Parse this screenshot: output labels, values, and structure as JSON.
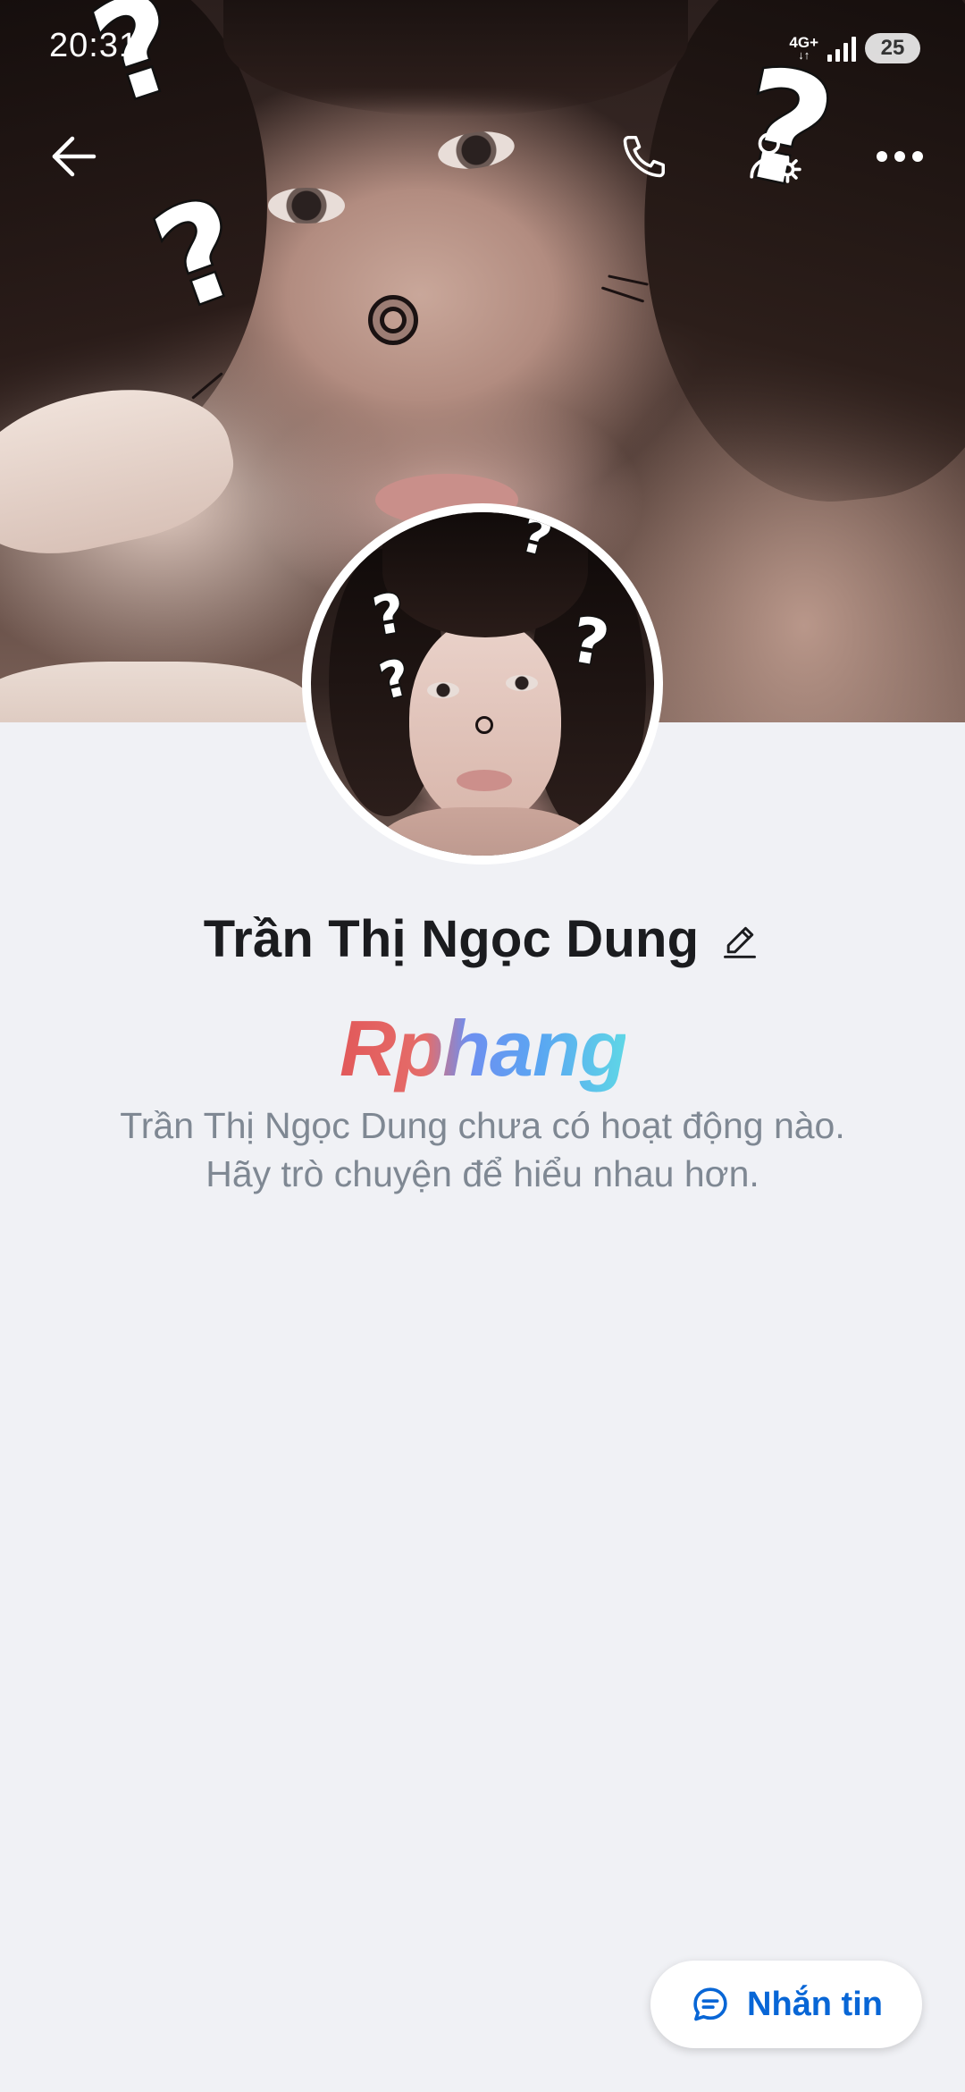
{
  "status_bar": {
    "time": "20:31",
    "network_type": "4G+",
    "battery_level": "25"
  },
  "toolbar": {
    "back_icon": "arrow-left-icon",
    "call_icon": "phone-icon",
    "settings_icon": "user-gear-icon",
    "more_icon": "ellipsis-icon"
  },
  "profile": {
    "name": "Trần Thị Ngọc Dung",
    "edit_icon": "pencil-icon",
    "watermark": "Rphang",
    "activity_message": "Trần Thị Ngọc Dung chưa có hoạt động nào. Hãy trò chuyện để hiểu nhau hơn."
  },
  "message_button": {
    "icon": "chat-bubble-icon",
    "label": "Nhắn tin"
  },
  "colors": {
    "accent": "#0866d6",
    "background": "#f0f1f5",
    "name_text": "#1b1c1f",
    "secondary_text": "#7f8893"
  }
}
